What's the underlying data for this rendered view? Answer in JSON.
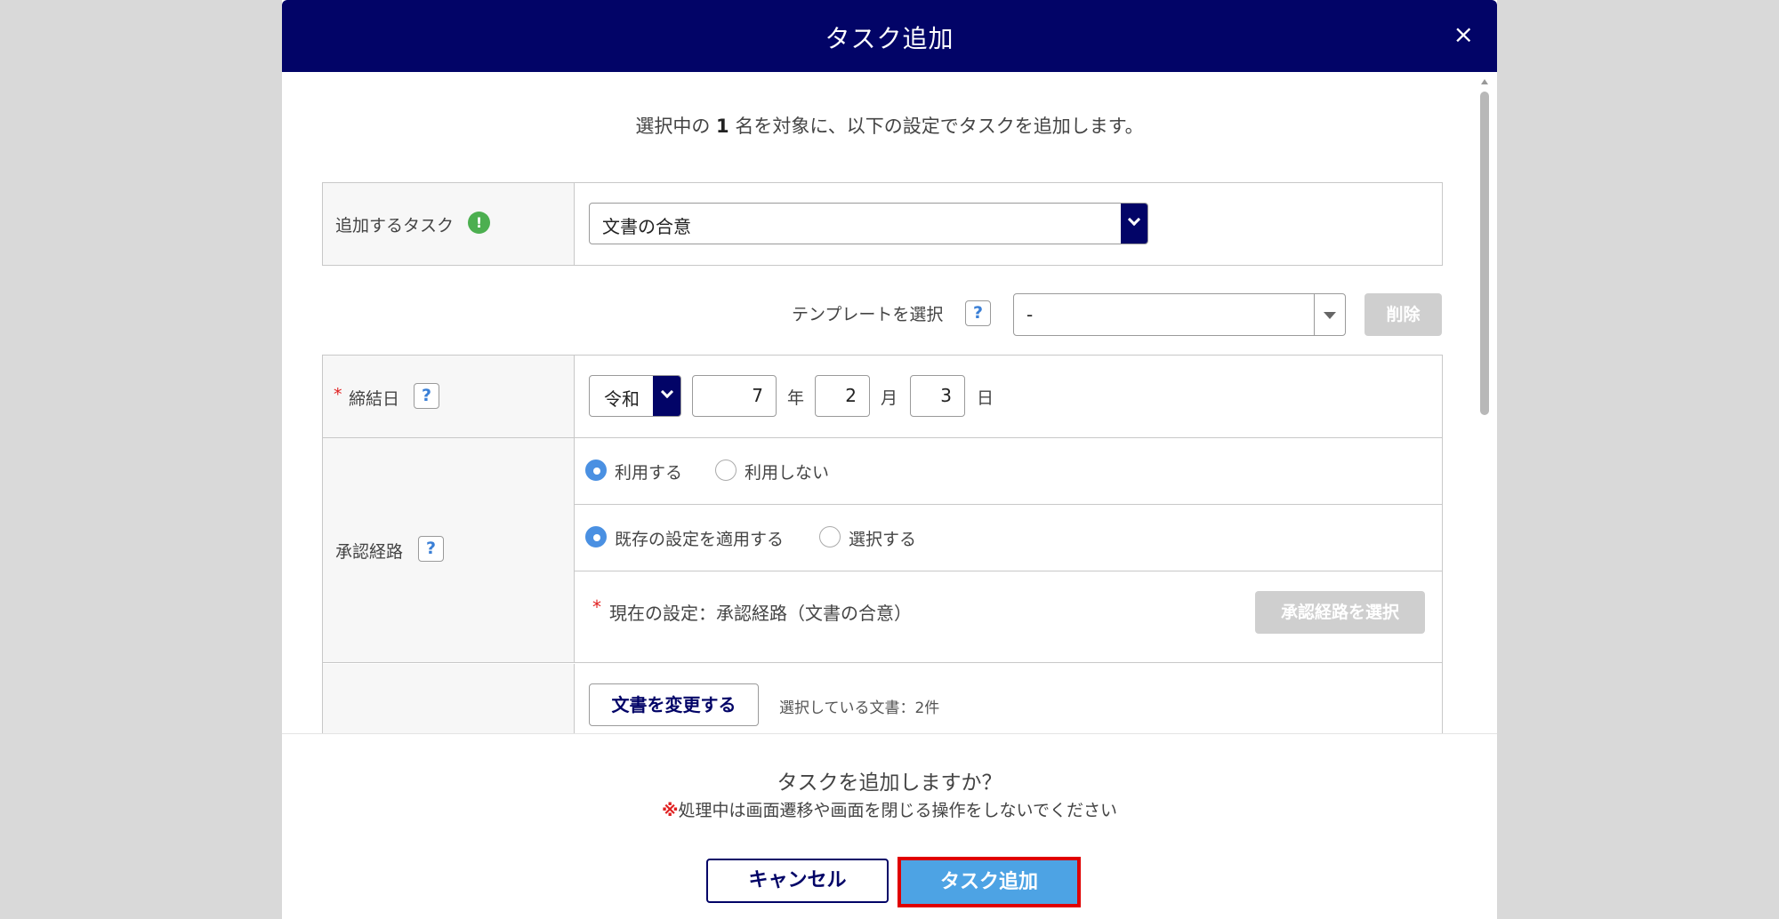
{
  "modal": {
    "title": "タスク追加",
    "close_label": "×"
  },
  "intro": {
    "prefix": "選択中の ",
    "count": "1",
    "suffix": " 名を対象に、以下の設定でタスクを追加します。"
  },
  "task_row": {
    "label": "追加するタスク",
    "info_icon": "!",
    "selected": "文書の合意"
  },
  "template": {
    "label": "テンプレートを選択",
    "help": "?",
    "selected": "-",
    "delete_label": "削除"
  },
  "date_row": {
    "required_mark": "*",
    "label": "締結日",
    "help": "?",
    "era": "令和",
    "year": "7",
    "year_unit": "年",
    "month": "2",
    "month_unit": "月",
    "day": "3",
    "day_unit": "日"
  },
  "approval_row": {
    "label": "承認経路",
    "help": "?",
    "use_options": [
      "利用する",
      "利用しない"
    ],
    "use_selected": 0,
    "apply_options": [
      "既存の設定を適用する",
      "選択する"
    ],
    "apply_selected": 0,
    "current_mark": "*",
    "current_setting": "現在の設定：承認経路（文書の合意）",
    "select_button": "承認経路を選択"
  },
  "document_row": {
    "change_button": "文書を変更する",
    "selected_docs": "選択している文書：2件"
  },
  "footer": {
    "confirm": "タスクを追加しますか？",
    "warn_mark": "※",
    "warn_text": "処理中は画面遷移や画面を閉じる操作をしないでください",
    "cancel": "キャンセル",
    "submit": "タスク追加"
  },
  "colors": {
    "header": "#020467",
    "primary": "#4da3e4",
    "highlight": "#e00000"
  }
}
